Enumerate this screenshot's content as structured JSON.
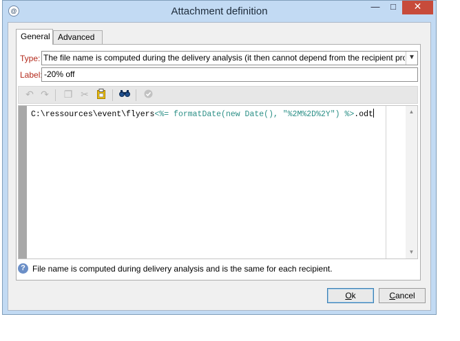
{
  "window": {
    "title": "Attachment definition",
    "icon_glyph": "@",
    "controls": {
      "minimize": "—",
      "maximize": "□",
      "close": "✕"
    }
  },
  "tabs": [
    {
      "label": "General",
      "active": true
    },
    {
      "label": "Advanced",
      "active": false
    }
  ],
  "form": {
    "type_label": "Type:",
    "type_value": "The file name is computed during the delivery analysis (it then cannot depend from the recipient pro",
    "label_label": "Label:",
    "label_value": "-20% off"
  },
  "toolbar": {
    "icons": [
      "undo-icon",
      "redo-icon",
      "copy-icon",
      "cut-icon",
      "paste-icon",
      "find-icon",
      "check-icon"
    ]
  },
  "editor": {
    "code_plain": "C:\\ressources\\event\\flyers",
    "code_expr": "<%= formatDate(new Date(), \"%2M%2D%2Y\") %>",
    "code_tail": ".odt"
  },
  "help": {
    "text": "File name is computed during delivery analysis and is the same for each recipient."
  },
  "buttons": {
    "ok": {
      "accel": "O",
      "rest": "k"
    },
    "cancel": {
      "accel": "C",
      "rest": "ancel"
    }
  },
  "colors": {
    "label_red": "#b3281a",
    "expr_teal": "#2b8f86",
    "close_red": "#c74b3b"
  }
}
